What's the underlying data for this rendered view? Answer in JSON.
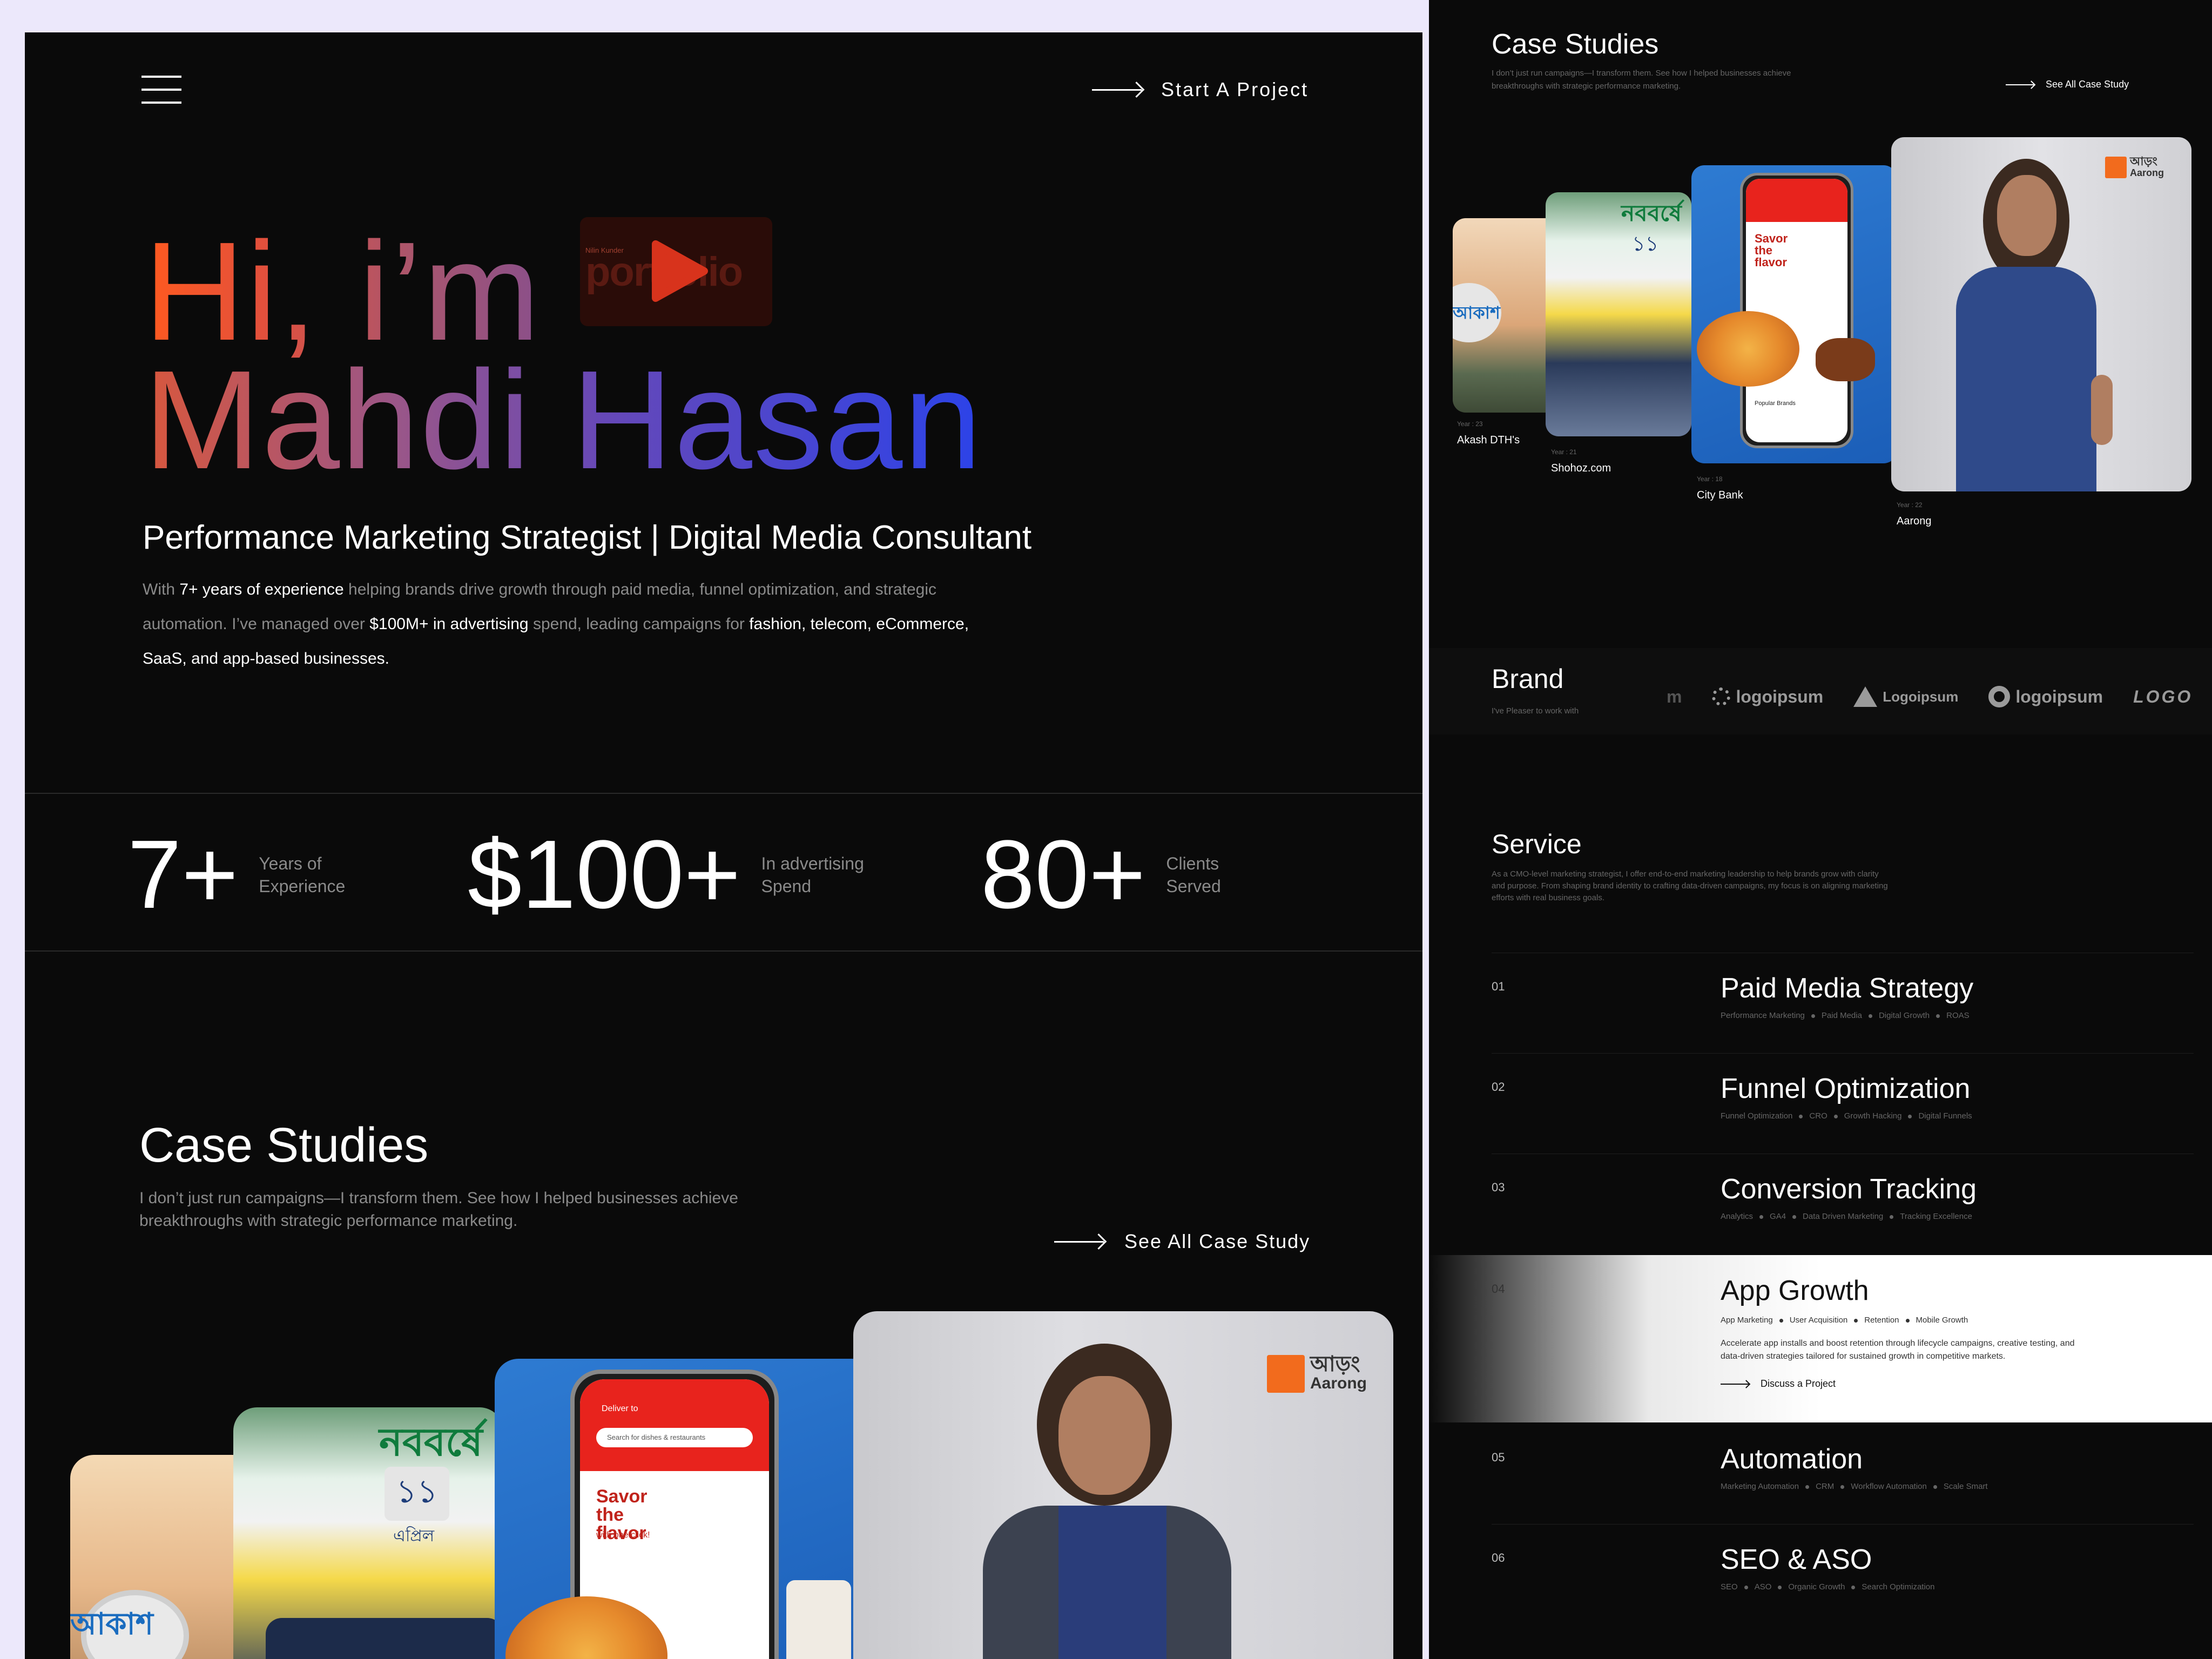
{
  "nav": {
    "cta_label": "Start A Project"
  },
  "hero": {
    "line1": "Hi, i’m",
    "line2": "Mahdi Hasan",
    "video_thumb_text": "portfolio",
    "video_thumb_small": "Nilin Kunder",
    "subtitle": "Performance Marketing Strategist | Digital Media Consultant",
    "bio": {
      "p1": "With ",
      "b1": "7+ years of experience",
      "p2": " helping brands drive growth through paid media, funnel optimization, and strategic automation. I’ve managed over ",
      "b2": "$100M+ in advertising",
      "p3": " spend, leading campaigns for ",
      "b3": "fashion, telecom, eCommerce, SaaS, and app-based businesses."
    }
  },
  "stats": [
    {
      "value": "7+",
      "label1": "Years of",
      "label2": "Experience"
    },
    {
      "value": "$100+",
      "label1": "In advertising",
      "label2": "Spend"
    },
    {
      "value": "80+",
      "label1": "Clients",
      "label2": "Served"
    }
  ],
  "case_studies": {
    "title": "Case Studies",
    "desc1": "I don’t just run campaigns—I transform them. See how I helped businesses achieve",
    "desc2": "breakthroughs with strategic performance marketing.",
    "see_all": "See All Case Study",
    "cards": [
      {
        "name": "Akash DTH's",
        "year": "Year : 23",
        "art": "আকাশ"
      },
      {
        "name": "Shohoz.com",
        "year": "Year : 21",
        "art": "নববর্ষে",
        "art2": "১১",
        "art3": "এপ্রিল"
      },
      {
        "name": "City Bank",
        "year": "Year : 18",
        "art": "Savor the flavor",
        "art2": "with one click!",
        "art3": "Deliver to",
        "art4": "Search for dishes & restaurants",
        "art5": "Popular Brands"
      },
      {
        "name": "Aarong",
        "year": "Year : 22",
        "art": "আড়ং",
        "art2": "Aarong"
      }
    ]
  },
  "brand": {
    "title": "Brand",
    "subtitle": "I've Pleaser to work with",
    "logos": [
      "m",
      "logoipsum",
      "Logoipsum",
      "logoipsum",
      "LOGO"
    ]
  },
  "service": {
    "title": "Service",
    "desc1": "As a CMO-level marketing strategist, I offer end-to-end marketing leadership to help brands grow with clarity",
    "desc2": "and purpose. From shaping brand identity to crafting data-driven campaigns, my focus is on aligning marketing",
    "desc3": "efforts with real business goals.",
    "items": [
      {
        "num": "01",
        "title": "Paid Media Strategy",
        "tags": [
          "Performance Marketing",
          "Paid Media",
          "Digital Growth",
          "ROAS"
        ]
      },
      {
        "num": "02",
        "title": "Funnel Optimization",
        "tags": [
          "Funnel Optimization",
          "CRO",
          "Growth Hacking",
          "Digital Funnels"
        ]
      },
      {
        "num": "03",
        "title": "Conversion Tracking",
        "tags": [
          "Analytics",
          "GA4",
          "Data Driven Marketing",
          "Tracking Excellence"
        ]
      },
      {
        "num": "04",
        "title": "App Growth",
        "tags": [
          "App Marketing",
          "User Acquisition",
          "Retention",
          "Mobile Growth"
        ],
        "desc1": "Accelerate app installs and boost retention through lifecycle campaigns, creative testing, and",
        "desc2": "data-driven strategies tailored for sustained growth in competitive markets.",
        "cta": "Discuss a Project"
      },
      {
        "num": "05",
        "title": "Automation",
        "tags": [
          "Marketing Automation",
          "CRM",
          "Workflow Automation",
          "Scale Smart"
        ]
      },
      {
        "num": "06",
        "title": "SEO & ASO",
        "tags": [
          "SEO",
          "ASO",
          "Organic Growth",
          "Search Optimization"
        ]
      }
    ]
  },
  "colors": {
    "bg": "#0a0a0a",
    "page": "#ece8fb",
    "accent_orange": "#ff5a1f",
    "accent_blue": "#2c43e8",
    "aarong_orange": "#f26b1d"
  }
}
